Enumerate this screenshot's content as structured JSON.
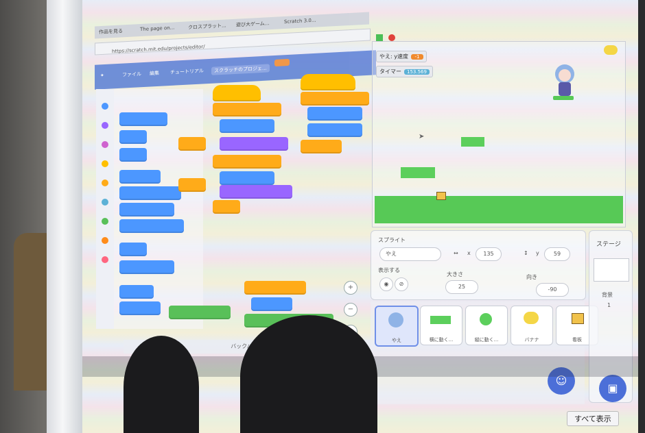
{
  "browser": {
    "tabs": [
      "作品を見る",
      "The page on...",
      "クロスプラット...",
      "遊び大ゲーム...",
      "Scratch 3.0..."
    ],
    "address": "https://scratch.mit.edu/projects/editor/"
  },
  "menubar": {
    "file_label": "ファイル",
    "edit_label": "編集",
    "tutorial_label": "チュートリアル",
    "project_title": "スクラッチのプロジェ..."
  },
  "monitors": [
    {
      "label": "やえ: y速度",
      "value": "-1"
    },
    {
      "label": "タイマー",
      "value": "153.569"
    }
  ],
  "sprite_info": {
    "sprite_label": "スプライト",
    "sprite_name": "やえ",
    "x_label": "x",
    "x_value": "135",
    "y_label": "y",
    "y_value": "59",
    "show_label": "表示する",
    "size_label": "大きさ",
    "size_value": "25",
    "direction_label": "向き",
    "direction_value": "-90"
  },
  "sprites": [
    {
      "name": "やえ",
      "selected": true,
      "color": "#dfe6fb"
    },
    {
      "name": "横に動く...",
      "selected": false,
      "color": "#5ccf5c"
    },
    {
      "name": "縦に動く...",
      "selected": false,
      "color": "#5ccf5c"
    },
    {
      "name": "バナナ",
      "selected": false,
      "color": "#f4d646"
    },
    {
      "name": "看板",
      "selected": false,
      "color": "#f1c24b"
    }
  ],
  "stage_panel": {
    "title": "ステージ",
    "backdrop_label": "背景",
    "backdrop_count": "1"
  },
  "backpack_label": "バックパック",
  "show_all_label": "すべて表示",
  "colors": {
    "motion": "#4c97ff",
    "looks": "#9966ff",
    "events": "#ffbf00",
    "control": "#ffab19",
    "operators": "#59c059",
    "variables": "#ff8c1a",
    "myblocks": "#ff6680"
  }
}
